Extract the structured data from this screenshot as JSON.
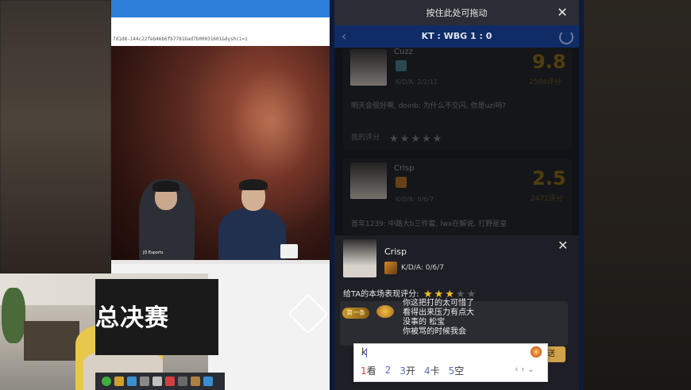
{
  "browser": {
    "url_fragment": "7d1d8-144c22feb46b6fb7781bad7b00031601&dyshci=1"
  },
  "broadcast": {
    "banner_text": "总决赛",
    "sponsor_label": "JD Esports"
  },
  "panel": {
    "drag_hint": "按住此处可拖动",
    "close_glyph": "✕",
    "back_glyph": "‹",
    "match_title": "KT : WBG    1 : 0"
  },
  "cards": [
    {
      "name": "Cuzz",
      "kda": "K/D/A: 2/2/11",
      "score": "9.8",
      "score_sub": "2504评分",
      "comment": "明天会很好啊, doinb: 为什么不交闪, 你是uzi吗?",
      "my_rating_label": "我的评分",
      "stars": 5
    },
    {
      "name": "Crisp",
      "kda": "K/D/A: 0/6/7",
      "score": "2.5",
      "score_sub": "2471评分",
      "comment": "首年1239: 中路大b三件套, lwx在解说, 打野是皇"
    }
  ],
  "popup": {
    "name": "Crisp",
    "kda": "K/D/A: 0/6/7",
    "close_glyph": "✕",
    "rate_label": "给TA的本场表现评分:",
    "rating": 3,
    "max_rating": 5,
    "badge": "第一条",
    "comments": [
      "你这把打的太可惜了",
      "看得出来压力有点大",
      "没事的 松宝",
      "你被骂的时候我会"
    ],
    "send_label": "送"
  },
  "ime": {
    "input": "k",
    "candidates": [
      {
        "num": "1",
        "text": "看"
      },
      {
        "num": "2",
        "text": ""
      },
      {
        "num": "3",
        "text": "开"
      },
      {
        "num": "4",
        "text": "卡"
      },
      {
        "num": "5",
        "text": "空"
      }
    ],
    "nav": "‹ › ⌄"
  },
  "colors": {
    "panel_border": "#1e5fcf",
    "match_bar": "#0f2c66",
    "star_active": "#f0c020",
    "star_inactive": "#5a5a5a",
    "send_button": "#d0a24a"
  }
}
